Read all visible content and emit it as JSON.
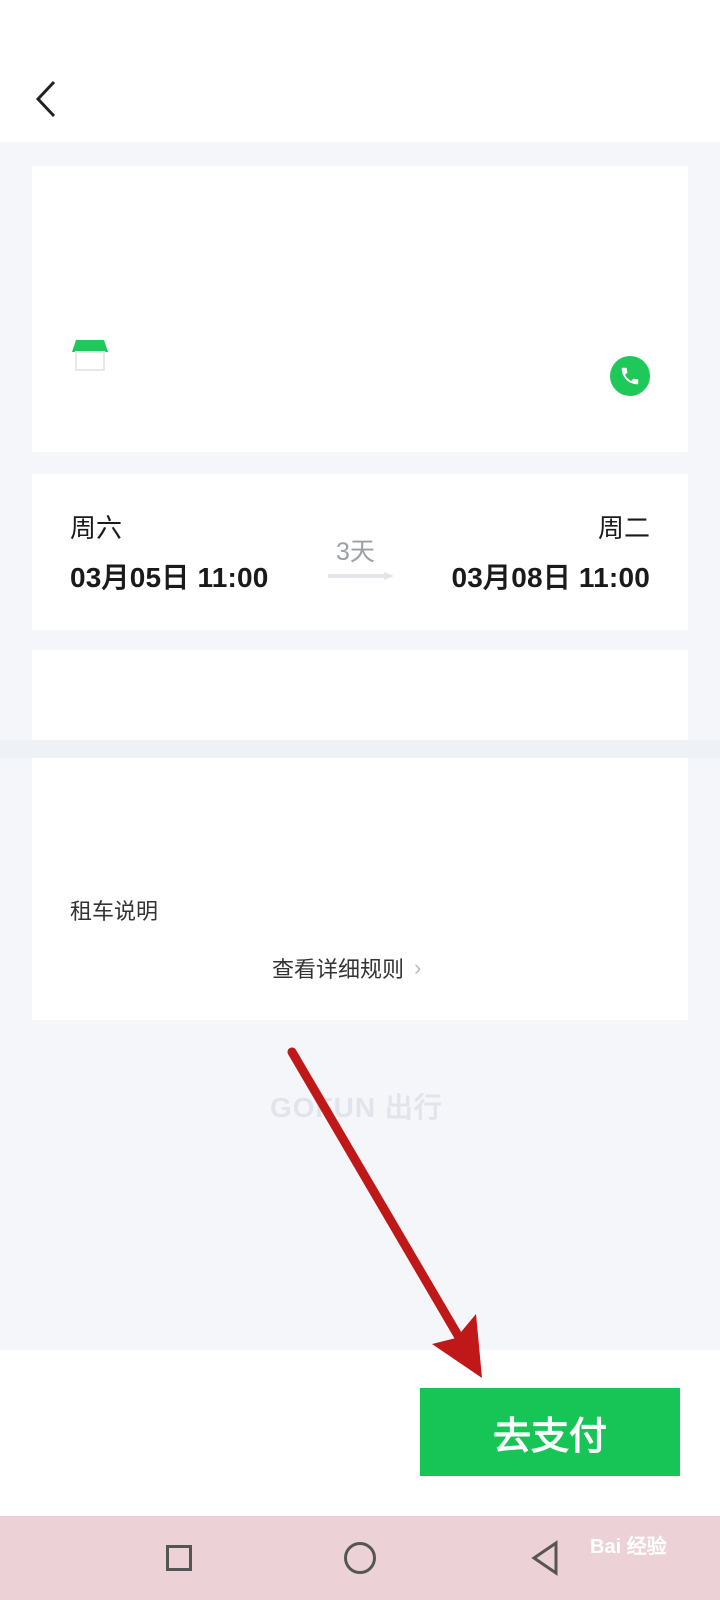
{
  "header": {
    "back_icon": "chevron-left-icon"
  },
  "store_card": {
    "store_icon": "store-icon",
    "call_icon": "phone-icon",
    "accent_color": "#1ec95a"
  },
  "rental": {
    "pickup": {
      "day": "周六",
      "datetime": "03月05日 11:00"
    },
    "return": {
      "day": "周二",
      "datetime": "03月08日 11:00"
    },
    "duration": "3天"
  },
  "notes": {
    "title": "租车说明",
    "rules_link": "查看详细规则"
  },
  "brand": {
    "logo_text": "GOFUN 出行"
  },
  "footer": {
    "pay_label": "去支付",
    "pay_color": "#17c556"
  },
  "system_nav": {
    "recent_icon": "square-icon",
    "home_icon": "circle-icon",
    "back_icon": "triangle-back-icon"
  },
  "watermark": {
    "text": "Bai 经验"
  }
}
